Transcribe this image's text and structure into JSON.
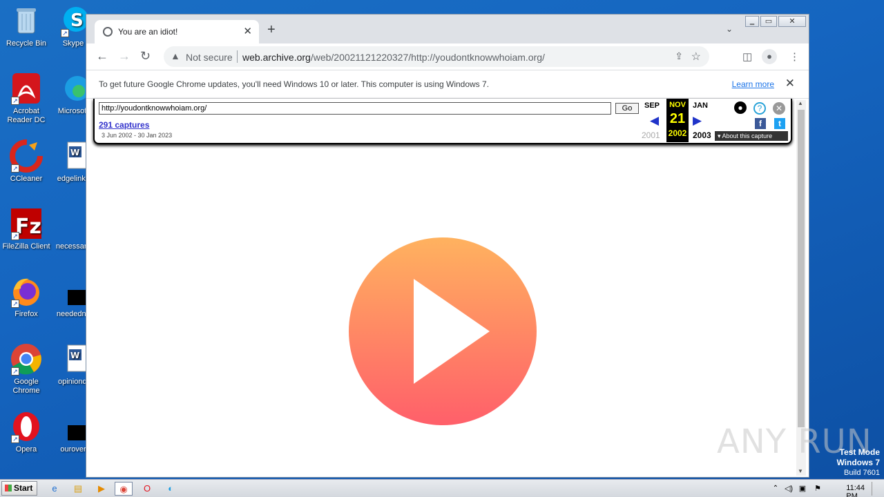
{
  "desktop": {
    "col1": [
      {
        "label": "Recycle Bin",
        "icon": "recycle-bin-icon"
      },
      {
        "label": "Acrobat Reader DC",
        "icon": "acrobat-icon"
      },
      {
        "label": "CCleaner",
        "icon": "ccleaner-icon"
      },
      {
        "label": "FileZilla Client",
        "icon": "filezilla-icon"
      },
      {
        "label": "Firefox",
        "icon": "firefox-icon"
      },
      {
        "label": "Google Chrome",
        "icon": "chrome-icon"
      },
      {
        "label": "Opera",
        "icon": "opera-icon"
      }
    ],
    "col2": [
      {
        "label": "Skype",
        "icon": "skype-icon"
      },
      {
        "label": "Microsoft",
        "icon": "edge-icon"
      },
      {
        "label": "edgelinks",
        "icon": "word-doc-icon"
      },
      {
        "label": "necessary",
        "icon": "file-icon"
      },
      {
        "label": "neededny",
        "icon": "black-file-icon"
      },
      {
        "label": "opinionqi",
        "icon": "word-doc-icon"
      },
      {
        "label": "ourover",
        "icon": "black-file-icon"
      }
    ]
  },
  "browser": {
    "tab_title": "You are an idiot!",
    "omnibox": {
      "security": "Not secure",
      "url_host": "web.archive.org",
      "url_path": "/web/20021121220327/http://youdontknowwhoiam.org/"
    },
    "infobar": {
      "message": "To get future Google Chrome updates, you'll need Windows 10 or later. This computer is using Windows 7.",
      "link": "Learn more"
    }
  },
  "wayback": {
    "url_value": "http://youdontknowwhoiam.org/",
    "go_label": "Go",
    "captures": "291 captures",
    "date_range": "3 Jun 2002 - 30 Jan 2023",
    "prev": {
      "month": "SEP",
      "year": "2001"
    },
    "current": {
      "month": "NOV",
      "day": "21",
      "year": "2002"
    },
    "next": {
      "month": "JAN",
      "year": "2003"
    },
    "about": "About this capture"
  },
  "watermark": "ANY RUN",
  "testmode": {
    "line1": "Test Mode",
    "line2": "Windows 7",
    "line3": "Build 7601"
  },
  "taskbar": {
    "start_label": "Start",
    "clock": "11:44 PM"
  },
  "colors": {
    "accent": "#1a73e8",
    "wayback_current": "#ffff00",
    "play_top": "#ffb25f",
    "play_bottom": "#ff5f6a"
  }
}
